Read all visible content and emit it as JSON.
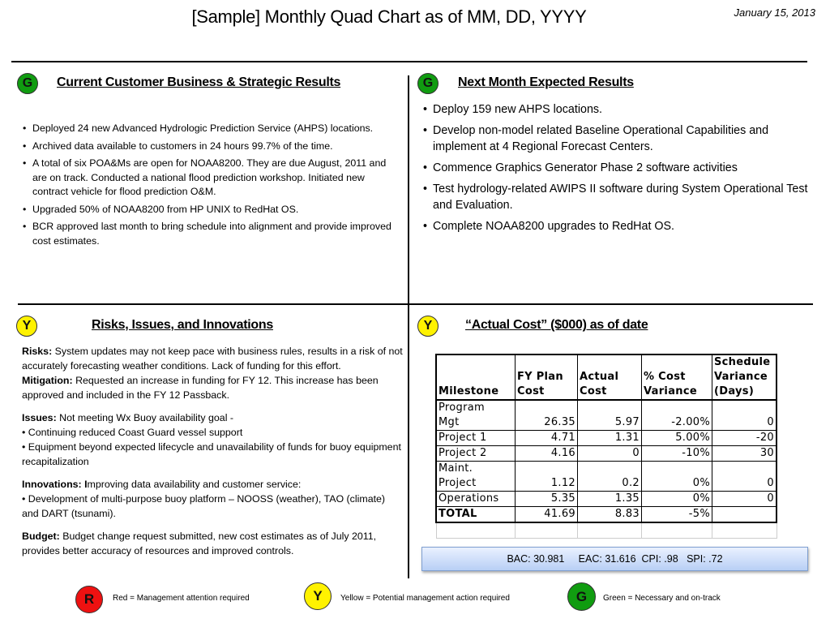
{
  "header": {
    "title": "[Sample] Monthly Quad Chart as of MM, DD, YYYY",
    "date": "January 15, 2013"
  },
  "quadrants": {
    "current": {
      "status": "G",
      "status_color": "#109c10",
      "title": "Current Customer Business & Strategic Results",
      "items": [
        "Deployed 24 new Advanced Hydrologic Prediction Service (AHPS) locations.",
        " Archived data available to customers in 24 hours 99.7% of the time.",
        "A total of six POA&Ms are open for NOAA8200.  They are due August, 2011 and are on track.  Conducted a national flood prediction workshop.  Initiated new contract vehicle for flood prediction O&M.",
        "Upgraded 50% of NOAA8200 from HP UNIX to RedHat OS.",
        "BCR approved last month to bring schedule into alignment and provide improved cost estimates."
      ]
    },
    "next": {
      "status": "G",
      "status_color": "#109c10",
      "title": "Next Month Expected Results",
      "items": [
        "Deploy 159 new AHPS locations.",
        "Develop non-model related Baseline Operational Capabilities and implement at 4 Regional Forecast Centers.",
        "Commence Graphics Generator Phase 2 software activities",
        "Test hydrology-related AWIPS II software during System Operational Test and Evaluation.",
        "Complete NOAA8200 upgrades to RedHat OS."
      ]
    },
    "risks": {
      "status": "Y",
      "status_color": "#fff200",
      "title": "Risks, Issues, and Innovations",
      "risks_label": "Risks:",
      "risks_text": " System updates may not keep pace with business rules, results in a risk of not accurately forecasting weather conditions.  Lack of funding for this effort.",
      "mitigation_label": "Mitigation:",
      "mitigation_text": "  Requested an increase in funding for FY 12.  This increase has been approved and included in the FY 12 Passback.",
      "issues_label": "Issues:",
      "issues_text": "   Not meeting Wx Buoy availability goal -",
      "issues_bullets": [
        "• Continuing reduced Coast Guard vessel support",
        "• Equipment beyond expected lifecycle and unavailability of  funds for buoy equipment recapitalization"
      ],
      "innovations_label": "Innovations:  I",
      "innovations_text": "mproving data availability and customer service:",
      "innovations_bullets": [
        "• Development of multi-purpose buoy platform – NOOSS (weather), TAO (climate) and DART (tsunami)."
      ],
      "budget_label": "Budget:",
      "budget_text": "  Budget change request submitted, new cost estimates as of July 2011, provides better accuracy of resources and improved controls."
    },
    "cost": {
      "status": "Y",
      "status_color": "#fff200",
      "title": "“Actual Cost” ($000) as of date",
      "columns": [
        "Milestone",
        "FY Plan Cost",
        "Actual Cost",
        "% Cost Variance",
        "Schedule Variance (Days)"
      ],
      "rows": [
        [
          "Program Mgt",
          "26.35",
          "5.97",
          "-2.00%",
          "0"
        ],
        [
          "Project 1",
          "4.71",
          "1.31",
          "5.00%",
          "-20"
        ],
        [
          "Project 2",
          "4.16",
          "0",
          "-10%",
          "30"
        ],
        [
          "Maint. Project",
          "1.12",
          "0.2",
          "0%",
          "0"
        ],
        [
          "Operations",
          "5.35",
          "1.35",
          "0%",
          "0"
        ]
      ],
      "total": [
        "TOTAL",
        "41.69",
        "8.83",
        "-5%",
        ""
      ],
      "evm_summary": "BAC: 30.981     EAC: 31.616  CPI: .98   SPI: .72"
    }
  },
  "legend": [
    {
      "letter": "R",
      "color": "#ee1111",
      "text": "Red = Management attention required"
    },
    {
      "letter": "Y",
      "color": "#fff200",
      "text": "Yellow = Potential management action required"
    },
    {
      "letter": "G",
      "color": "#109c10",
      "text": "Green = Necessary and on-track"
    }
  ]
}
